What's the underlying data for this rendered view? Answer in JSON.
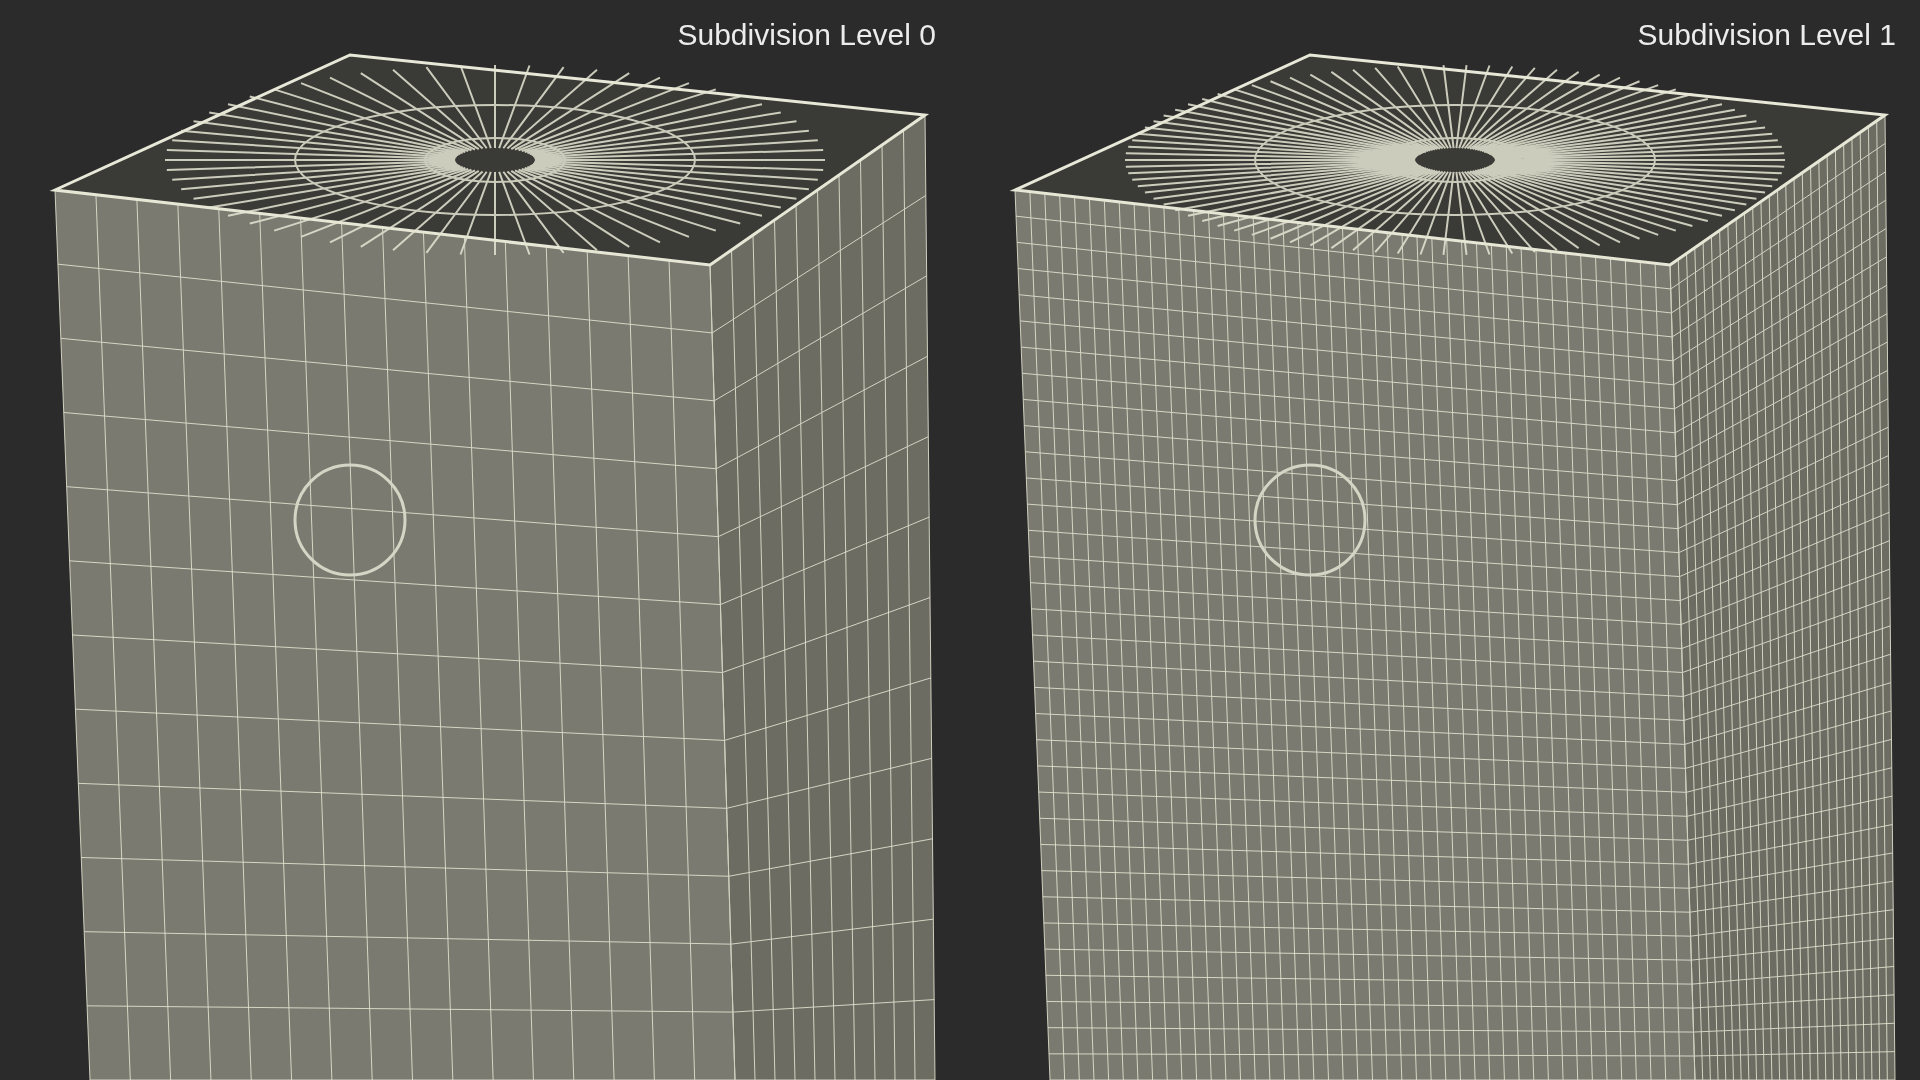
{
  "panels": [
    {
      "label": "Subdivision Level 0",
      "kind": "coarse"
    },
    {
      "label": "Subdivision Level 1",
      "kind": "fine"
    }
  ]
}
